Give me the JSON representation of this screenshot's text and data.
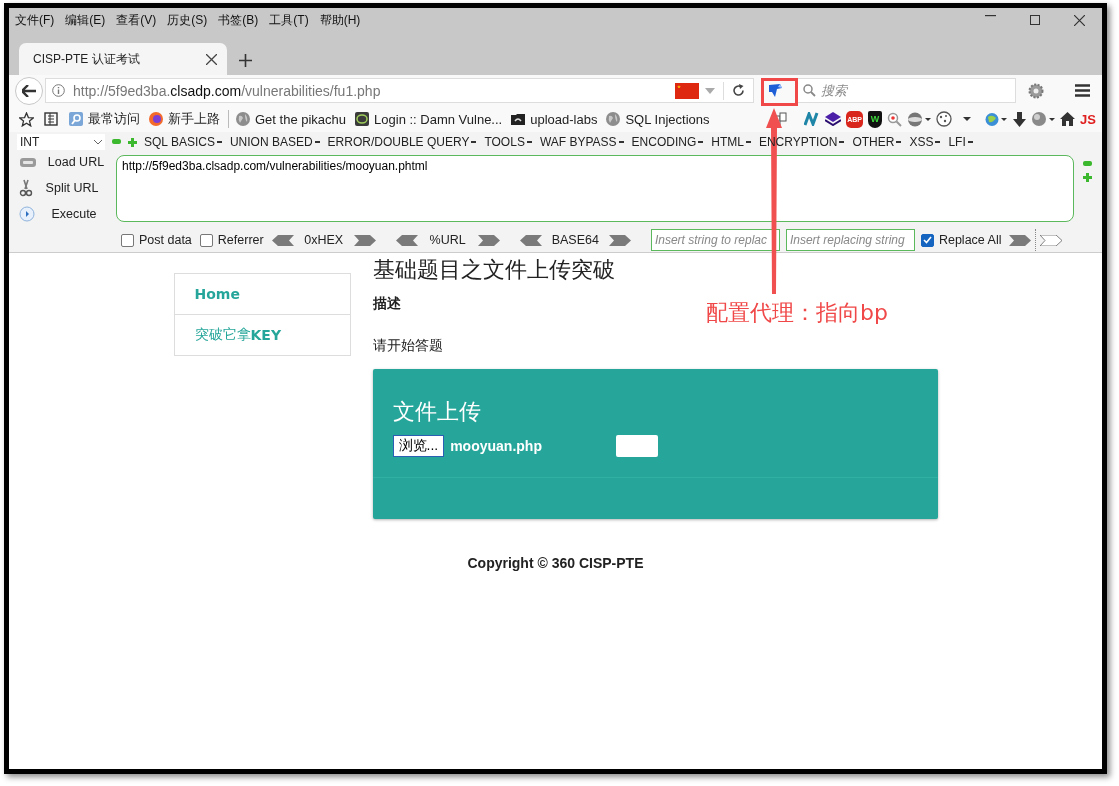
{
  "menu_bar": [
    "文件(F)",
    "编辑(E)",
    "查看(V)",
    "历史(S)",
    "书签(B)",
    "工具(T)",
    "帮助(H)"
  ],
  "tabs": [
    {
      "title": "CISP-PTE 认证考试",
      "selected": true
    }
  ],
  "address_bar": {
    "url": "http://5f9ed3ba.**clsadp.com**/vulnerabilities/fu1.php"
  },
  "search": {
    "placeholder": "搜索"
  },
  "bookmarks": [
    {
      "label": "最常访问",
      "kind": "folder"
    },
    {
      "label": "新手上路",
      "kind": "firefox"
    },
    {
      "label": "Get the pikachu",
      "kind": "globe"
    },
    {
      "label": "Login :: Damn Vulne...",
      "kind": "dvwa"
    },
    {
      "label": "upload-labs",
      "kind": "camera"
    },
    {
      "label": "SQL Injections",
      "kind": "globe"
    }
  ],
  "extension_badges": {
    "abp": "ABP",
    "shield": "W",
    "js": "JS"
  },
  "hackbar": {
    "type_select": "INT",
    "menus": [
      "SQL BASICS",
      "UNION BASED",
      "ERROR/DOUBLE QUERY",
      "TOOLS",
      "WAF BYPASS",
      "ENCODING",
      "HTML",
      "ENCRYPTION",
      "OTHER",
      "XSS",
      "LFI"
    ],
    "actions": [
      {
        "label": "Load URL",
        "kind": "load"
      },
      {
        "label": "Split URL",
        "kind": "split"
      },
      {
        "label": "Execute",
        "kind": "execute"
      }
    ],
    "url_field": {
      "value": "http://5f9ed3ba.clsadp.com/vulnerabilities/mooyuan.phtml"
    },
    "options": [
      {
        "label": "Post data",
        "checked": false
      },
      {
        "label": "Referrer",
        "checked": false
      }
    ],
    "encoders": [
      "0xHEX",
      "%URL",
      "BASE64"
    ],
    "replace": {
      "find_placeholder": "Insert string to replac",
      "replace_placeholder": "Insert replacing string",
      "replace_all": {
        "label": "Replace All",
        "checked": true
      }
    }
  },
  "sidebar": [
    {
      "label": "Home",
      "selected": true
    },
    {
      "label": "突破它拿**KEY**",
      "selected": false
    }
  ],
  "content": {
    "title": "基础题目之文件上传突破",
    "heading": "描述",
    "text": "请开始答题",
    "panel": {
      "title": "文件上传",
      "browse_button": "浏览...",
      "file_name": "mooyuan.php"
    }
  },
  "footer": "Copyright © 360 CISP-PTE",
  "annotation": {
    "label": "配置代理：指向bp"
  }
}
